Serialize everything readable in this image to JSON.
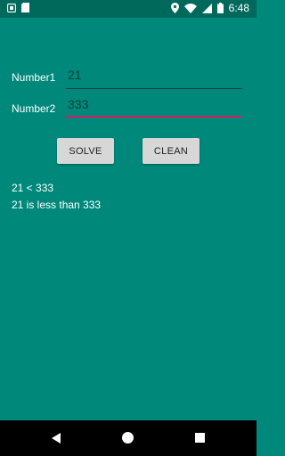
{
  "status_bar": {
    "time": "6:48",
    "icons": [
      "notification-icon",
      "sd-card-icon",
      "location-icon",
      "wifi-icon",
      "signal-icon",
      "battery-icon"
    ]
  },
  "form": {
    "number1_label": "Number1",
    "number1_value": "21",
    "number2_label": "Number2",
    "number2_value": "333"
  },
  "buttons": {
    "solve": "SOLVE",
    "clean": "CLEAN"
  },
  "results": {
    "line1": "21 < 333",
    "line2": "21 is less than 333"
  },
  "nav_bar": {
    "icons": [
      "back-icon",
      "home-icon",
      "recents-icon"
    ]
  },
  "colors": {
    "background": "#00897b",
    "status_bar": "#00695c",
    "accent": "#d81b60",
    "button": "#d7d7d7"
  }
}
